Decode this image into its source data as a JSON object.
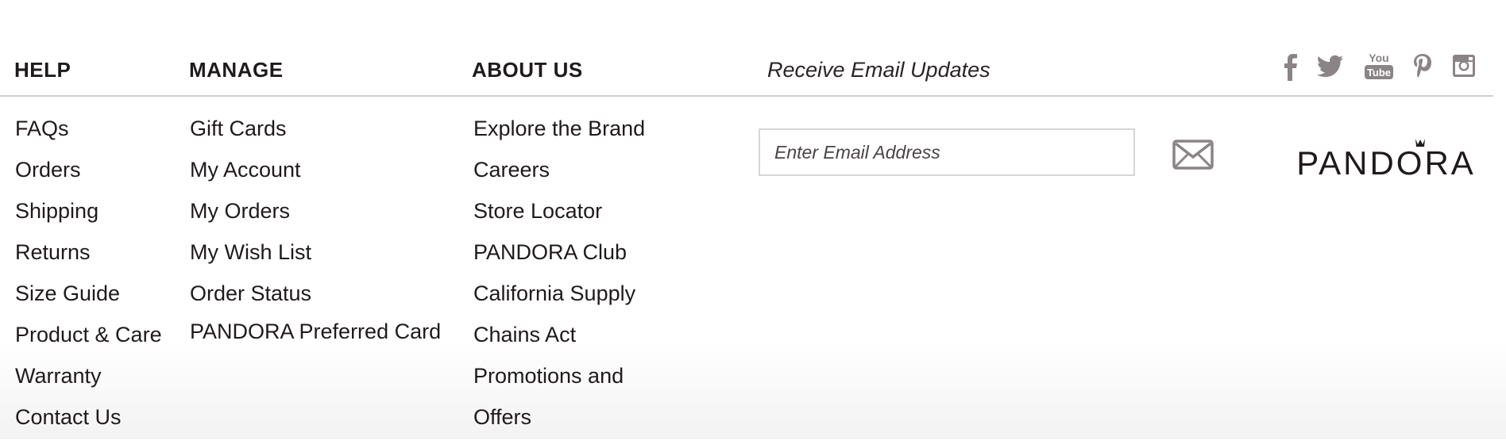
{
  "help": {
    "heading": "HELP",
    "items": [
      "FAQs",
      "Orders",
      "Shipping",
      "Returns",
      "Size Guide",
      "Product & Care",
      "Warranty",
      "Contact Us"
    ]
  },
  "manage": {
    "heading": "MANAGE",
    "items": [
      "Gift Cards",
      "My Account",
      "My Orders",
      "My Wish List",
      "Order Status",
      "PANDORA Preferred Card"
    ]
  },
  "about": {
    "heading": "ABOUT US",
    "items": [
      "Explore the Brand",
      "Careers",
      "Store Locator",
      "PANDORA Club",
      "California Supply",
      "Chains Act",
      "Promotions and",
      "Offers"
    ]
  },
  "email": {
    "heading": "Receive Email Updates",
    "placeholder": "Enter Email Address",
    "value": ""
  },
  "social": {
    "icons": [
      "facebook-icon",
      "twitter-icon",
      "youtube-icon",
      "pinterest-icon",
      "instagram-icon"
    ],
    "youtube_text_top": "You",
    "youtube_text_bottom": "Tube"
  },
  "brand": {
    "logo_text": "PANDORA"
  },
  "colors": {
    "text": "#1f1a1c",
    "icon_gray": "#8a8487",
    "divider": "#cfcfcf",
    "input_border": "#d8d5d6"
  }
}
